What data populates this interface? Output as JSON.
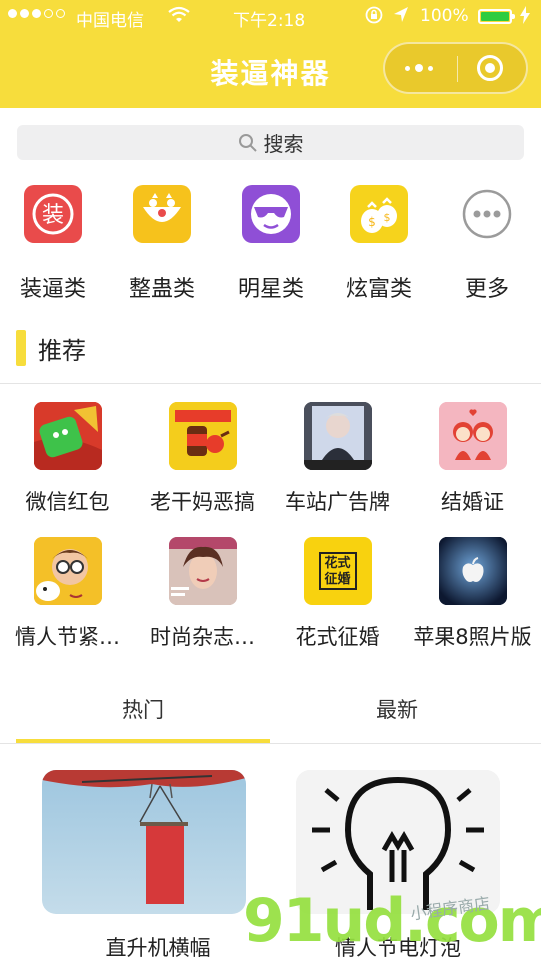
{
  "status": {
    "carrier": "中国电信",
    "time": "下午2:18",
    "battery": "100%"
  },
  "nav": {
    "title": "装逼神器"
  },
  "search": {
    "label": "搜索"
  },
  "categories": [
    {
      "label": "装逼类",
      "icon": "zhuang-badge-icon",
      "color": "#e94b4b"
    },
    {
      "label": "整蛊类",
      "icon": "clown-face-icon",
      "color": "#f6c21c"
    },
    {
      "label": "明星类",
      "icon": "sunglasses-face-icon",
      "color": "#8f4fd6"
    },
    {
      "label": "炫富类",
      "icon": "money-bags-icon",
      "color": "#f6d31c"
    },
    {
      "label": "更多",
      "icon": "more-dots-icon",
      "color": "#9b9b9b"
    }
  ],
  "section": {
    "title": "推荐"
  },
  "recommended": [
    {
      "label": "微信红包",
      "icon": "wechat-red-packet-thumb"
    },
    {
      "label": "老干妈恶搞",
      "icon": "laoganma-jar-thumb"
    },
    {
      "label": "车站广告牌",
      "icon": "station-billboard-thumb"
    },
    {
      "label": "结婚证",
      "icon": "marriage-certificate-thumb"
    },
    {
      "label": "情人节紧…",
      "icon": "cartoon-boy-dog-thumb"
    },
    {
      "label": "时尚杂志…",
      "icon": "fashion-magazine-thumb"
    },
    {
      "label": "花式征婚",
      "icon": "huashi-zhenghun-thumb",
      "thumb_text": "花式征婚"
    },
    {
      "label": "苹果8照片版",
      "icon": "apple-logo-thumb"
    }
  ],
  "tabs": {
    "hot": "热门",
    "latest": "最新",
    "active": "hot"
  },
  "cards": [
    {
      "label": "直升机横幅",
      "icon": "helicopter-banner-image"
    },
    {
      "label": "情人节电灯泡",
      "icon": "light-bulb-image"
    }
  ],
  "watermark": {
    "main": "91ud.com",
    "sub": "小程序商店"
  },
  "colors": {
    "accent": "#f7dd3c"
  }
}
